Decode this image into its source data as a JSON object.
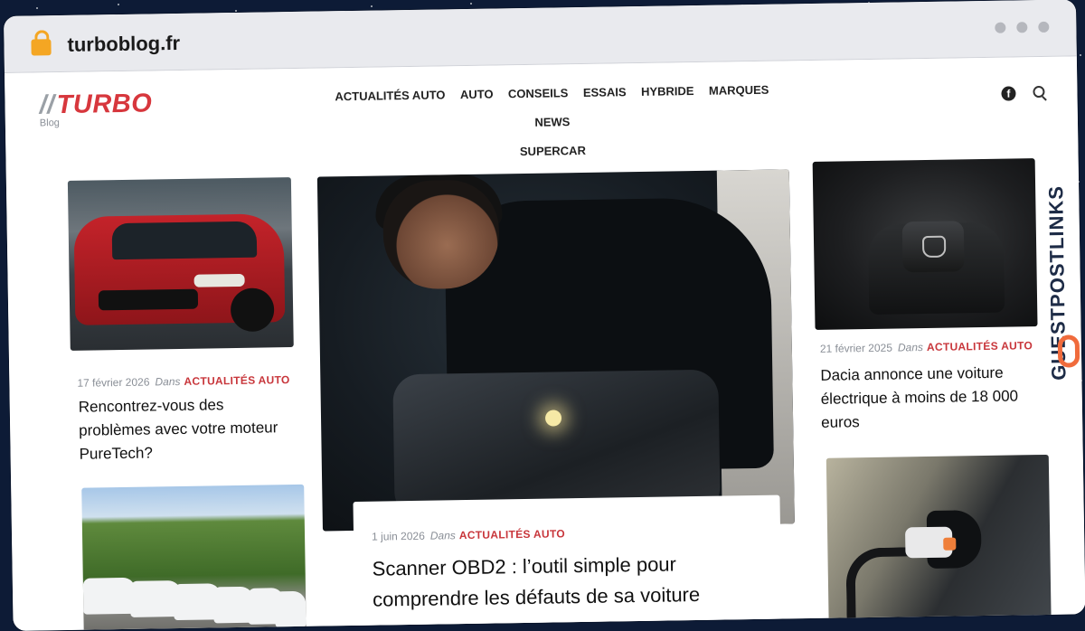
{
  "browser": {
    "url": "turboblog.fr"
  },
  "site": {
    "logo_text": "TURBO",
    "logo_slash": "//",
    "logo_sub": "Blog",
    "nav": [
      "ACTUALITÉS AUTO",
      "AUTO",
      "CONSEILS",
      "ESSAIS",
      "HYBRIDE",
      "MARQUES",
      "NEWS",
      "SUPERCAR"
    ],
    "icons": [
      "facebook-icon",
      "search-icon"
    ]
  },
  "watermark": {
    "text": "GUESTPOSTLINKS"
  },
  "articles": [
    {
      "date": "17 février 2026",
      "in": "Dans",
      "category": "ACTUALITÉS AUTO",
      "title": "Rencontrez-vous des problèmes avec votre moteur PureTech?"
    },
    {
      "date": "1 juin 2026",
      "in": "Dans",
      "category": "ACTUALITÉS AUTO",
      "title": "Scanner OBD2 : l’outil simple pour comprendre les défauts de sa voiture"
    },
    {
      "date": "21 février 2025",
      "in": "Dans",
      "category": "ACTUALITÉS AUTO",
      "title": "Dacia annonce une voiture électrique à moins de 18 000 euros"
    }
  ],
  "colors": {
    "accent": "#d7373d",
    "category": "#c8363b",
    "background": "#0d1b36"
  }
}
